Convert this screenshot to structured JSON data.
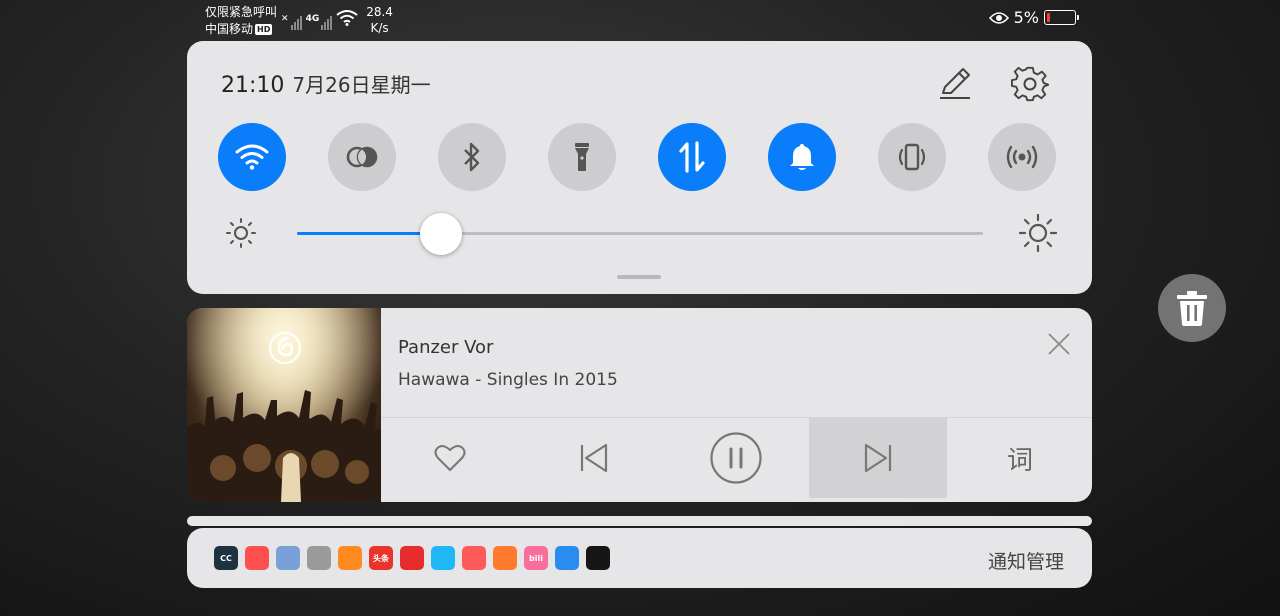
{
  "status_bar": {
    "emergency_text": "仅限紧急呼叫",
    "carrier": "中国移动",
    "hd_badge": "HD",
    "network_type": "4G",
    "net_speed_value": "28.4",
    "net_speed_unit": "K/s",
    "battery_percent": "5%",
    "battery_level": 0.05,
    "battery_color": "#ff3b30"
  },
  "quick_settings": {
    "time": "21:10",
    "date": "7月26日星期一",
    "edit_icon": "pencil-icon",
    "settings_icon": "gear-icon",
    "toggles": [
      {
        "name": "wifi",
        "icon": "wifi-icon",
        "active": true
      },
      {
        "name": "dual-sim",
        "icon": "sim-circles-icon",
        "active": false
      },
      {
        "name": "bluetooth",
        "icon": "bluetooth-icon",
        "active": false
      },
      {
        "name": "flashlight",
        "icon": "flashlight-icon",
        "active": false
      },
      {
        "name": "mobile-data",
        "icon": "data-arrows-icon",
        "active": true
      },
      {
        "name": "sound",
        "icon": "bell-icon",
        "active": true
      },
      {
        "name": "auto-rotate",
        "icon": "rotate-phone-icon",
        "active": false
      },
      {
        "name": "hotspot",
        "icon": "hotspot-icon",
        "active": false
      }
    ],
    "brightness_level": 0.21,
    "accent_color": "#0a7dfa"
  },
  "media": {
    "song_title": "Panzer Vor",
    "artist_album": "Hawawa - Singles In 2015",
    "lyrics_label": "词",
    "liked": false,
    "playing": true
  },
  "notifications": {
    "apps": [
      {
        "name": "cc",
        "color": "#1d3440",
        "label": "CC"
      },
      {
        "name": "video-camera",
        "color": "#ff5050",
        "label": ""
      },
      {
        "name": "hourglass",
        "color": "#7aa0d8",
        "label": ""
      },
      {
        "name": "files",
        "color": "#9a9a9a",
        "label": ""
      },
      {
        "name": "uc-browser",
        "color": "#ff8a1f",
        "label": ""
      },
      {
        "name": "toutiao",
        "color": "#e8342a",
        "label": "头条"
      },
      {
        "name": "netease-music",
        "color": "#e62d2d",
        "label": ""
      },
      {
        "name": "qq",
        "color": "#1fb7f4",
        "label": ""
      },
      {
        "name": "battery-app",
        "color": "#ff5a5a",
        "label": ""
      },
      {
        "name": "video-player",
        "color": "#ff7a2e",
        "label": ""
      },
      {
        "name": "bilibili",
        "color": "#f76f9a",
        "label": "bili"
      },
      {
        "name": "hotspot-app",
        "color": "#2b8cf0",
        "label": ""
      },
      {
        "name": "tiktok",
        "color": "#161616",
        "label": ""
      }
    ],
    "manage_label": "通知管理"
  },
  "trash_icon": "trash-icon"
}
